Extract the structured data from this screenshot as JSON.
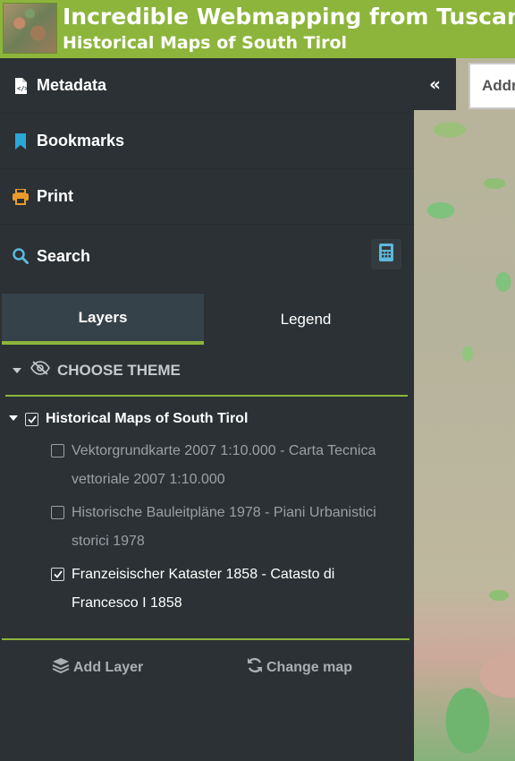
{
  "header": {
    "title": "Incredible Webmapping from Tuscany -",
    "subtitle": "Historical Maps of South Tirol"
  },
  "sidebar": {
    "menu": [
      {
        "label": "Metadata",
        "icon": "file-code-icon"
      },
      {
        "label": "Bookmarks",
        "icon": "bookmark-icon"
      },
      {
        "label": "Print",
        "icon": "printer-icon"
      },
      {
        "label": "Search",
        "icon": "search-icon"
      }
    ],
    "calc_icon": "calculator-icon",
    "tabs": [
      {
        "label": "Layers",
        "active": true
      },
      {
        "label": "Legend",
        "active": false
      }
    ],
    "theme_label": "CHOOSE THEME",
    "tree": {
      "root_label": "Historical Maps of South Tirol",
      "layers": [
        {
          "label": "Vektorgrundkarte 2007 1:10.000 - Carta Tecnica vettoriale 2007 1:10.000",
          "checked": false
        },
        {
          "label": "Historische Bauleitpläne 1978 - Piani Urbanistici storici 1978",
          "checked": false
        },
        {
          "label": "Franzeisischer Kataster 1858 - Catasto di Francesco I 1858",
          "checked": true
        }
      ]
    },
    "buttons": {
      "add_layer": "Add Layer",
      "change_map": "Change map"
    }
  },
  "map": {
    "collapse_glyph": "«",
    "box_text": "Addr"
  },
  "colors": {
    "accent": "#8db53c",
    "sidebar_bg": "#2b3134",
    "bookmark": "#2aa8d8",
    "print": "#e99a2b",
    "search": "#5cb8dc",
    "calc": "#5cb8dc"
  }
}
